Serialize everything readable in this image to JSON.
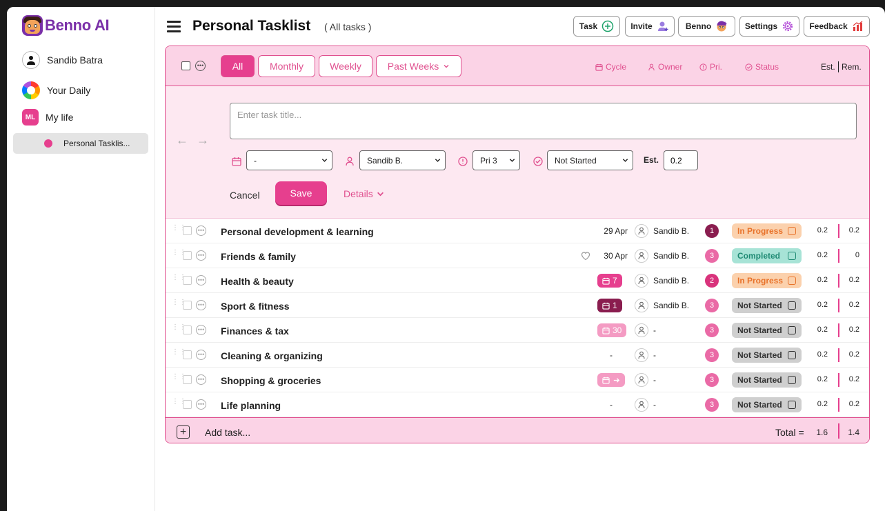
{
  "app": {
    "brand_name": "Benno",
    "brand_suffix": "AI"
  },
  "sidebar": {
    "user": "Sandib Batra",
    "items": [
      {
        "label": "Your Daily"
      },
      {
        "label": "My life",
        "badge": "ML"
      },
      {
        "label": "Personal Tasklis..."
      }
    ]
  },
  "header": {
    "title": "Personal Tasklist",
    "subtitle": "( All tasks )",
    "buttons": [
      "Task",
      "Invite",
      "Benno",
      "Settings",
      "Feedback"
    ]
  },
  "toolbar": {
    "filters": [
      "All",
      "Monthly",
      "Weekly",
      "Past Weeks"
    ],
    "columns": {
      "cycle": "Cycle",
      "owner": "Owner",
      "priority": "Pri.",
      "status": "Status",
      "est": "Est.",
      "rem": "Rem."
    }
  },
  "editor": {
    "title_placeholder": "Enter task title...",
    "cycle_value": "-",
    "owner_value": "Sandib B.",
    "priority_value": "Pri 3",
    "status_value": "Not Started",
    "est_label": "Est.",
    "est_value": "0.2",
    "cancel_label": "Cancel",
    "save_label": "Save",
    "details_label": "Details"
  },
  "tasks": [
    {
      "name": "Personal development & learning",
      "date": "29 Apr",
      "owner": "Sandib B.",
      "priority": "1",
      "status": "In Progress",
      "est": "0.2",
      "rem": "0.2"
    },
    {
      "name": "Friends & family",
      "date": "30 Apr",
      "owner": "Sandib B.",
      "priority": "3",
      "status": "Completed",
      "est": "0.2",
      "rem": "0"
    },
    {
      "name": "Health & beauty",
      "cycle": "7",
      "owner": "Sandib B.",
      "priority": "2",
      "status": "In Progress",
      "est": "0.2",
      "rem": "0.2"
    },
    {
      "name": "Sport & fitness",
      "cycle": "1",
      "owner": "Sandib B.",
      "priority": "3",
      "status": "Not Started",
      "est": "0.2",
      "rem": "0.2"
    },
    {
      "name": "Finances & tax",
      "cycle": "30",
      "owner": "-",
      "priority": "3",
      "status": "Not Started",
      "est": "0.2",
      "rem": "0.2"
    },
    {
      "name": "Cleaning & organizing",
      "date": "-",
      "owner": "-",
      "priority": "3",
      "status": "Not Started",
      "est": "0.2",
      "rem": "0.2"
    },
    {
      "name": "Shopping & groceries",
      "owner": "-",
      "priority": "3",
      "status": "Not Started",
      "est": "0.2",
      "rem": "0.2"
    },
    {
      "name": "Life planning",
      "date": "-",
      "owner": "-",
      "priority": "3",
      "status": "Not Started",
      "est": "0.2",
      "rem": "0.2"
    }
  ],
  "footer": {
    "add_label": "Add task...",
    "total_label": "Total =",
    "total_est": "1.6",
    "total_rem": "1.4"
  },
  "colors": {
    "accent": "#e63f8e",
    "brand": "#7a2fa8",
    "in_progress_bg": "#fbd1ad",
    "in_progress_fg": "#e8722a",
    "completed_bg": "#a7e3d6",
    "completed_fg": "#1e8a73",
    "not_started_bg": "#cfcfcf",
    "pri1": "#8a1d4f",
    "pri2": "#d9337c",
    "pri3": "#ea6aa6"
  }
}
